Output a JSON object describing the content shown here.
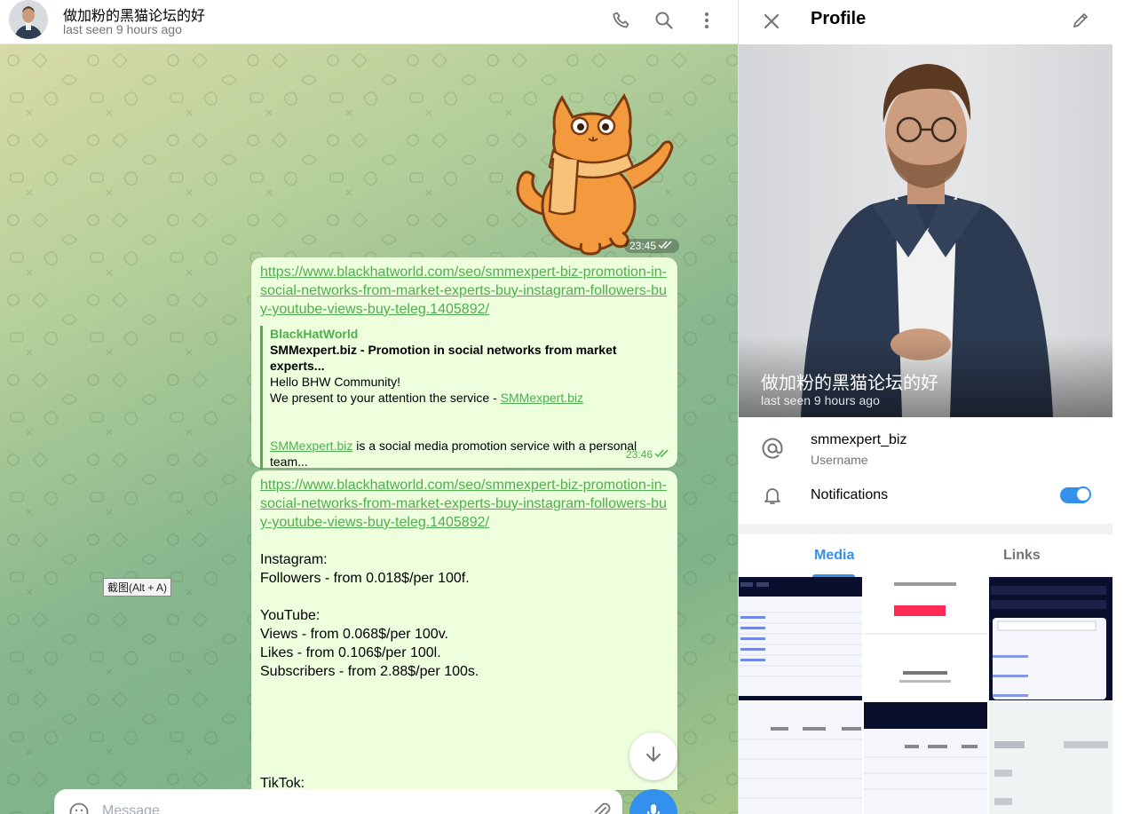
{
  "chat": {
    "title": "做加粉的黑猫论坛的好",
    "status": "last seen 9 hours ago",
    "sticker_time": "23:45",
    "messages": [
      {
        "url": "https://www.blackhatworld.com/seo/smmexpert-biz-promotion-in-social-networks-from-market-experts-buy-instagram-followers-buy-youtube-views-buy-teleg.1405892/",
        "preview_site": "BlackHatWorld",
        "preview_title": "SMMexpert.biz - Promotion in social networks from market experts...",
        "preview_line1": "Hello BHW Community!",
        "preview_line2_text": "We present to your attention the service - ",
        "preview_line2_link": "SMMexpert.biz",
        "preview_line3_link": "SMMexpert.biz",
        "preview_line3_text": " is a social media promotion service with a personal team...",
        "time": "23:46"
      },
      {
        "url": "https://www.blackhatworld.com/seo/smmexpert-biz-promotion-in-social-networks-from-market-experts-buy-instagram-followers-buy-youtube-views-buy-teleg.1405892/",
        "lines": [
          "Instagram:",
          "Followers - from 0.018$/per 100f.",
          "",
          "YouTube:",
          "Views - from 0.068$/per 100v.",
          "Likes - from 0.106$/per 100l.",
          "Subscribers - from 2.88$/per 100s.",
          "",
          "",
          "",
          "",
          "",
          "TikTok:"
        ]
      }
    ],
    "screenshot_tip": "截图(Alt + A)",
    "composer_placeholder": "Message"
  },
  "profile": {
    "title": "Profile",
    "name": "做加粉的黑猫论坛的好",
    "status": "last seen 9 hours ago",
    "username": "smmexpert_biz",
    "username_label": "Username",
    "notifications_label": "Notifications",
    "notifications_enabled": true,
    "tabs": [
      "Media",
      "Links"
    ],
    "active_tab": "Media"
  },
  "colors": {
    "accent": "#3390ec",
    "outgoing_bubble": "#eeffde",
    "link_green": "#4fae4e"
  }
}
